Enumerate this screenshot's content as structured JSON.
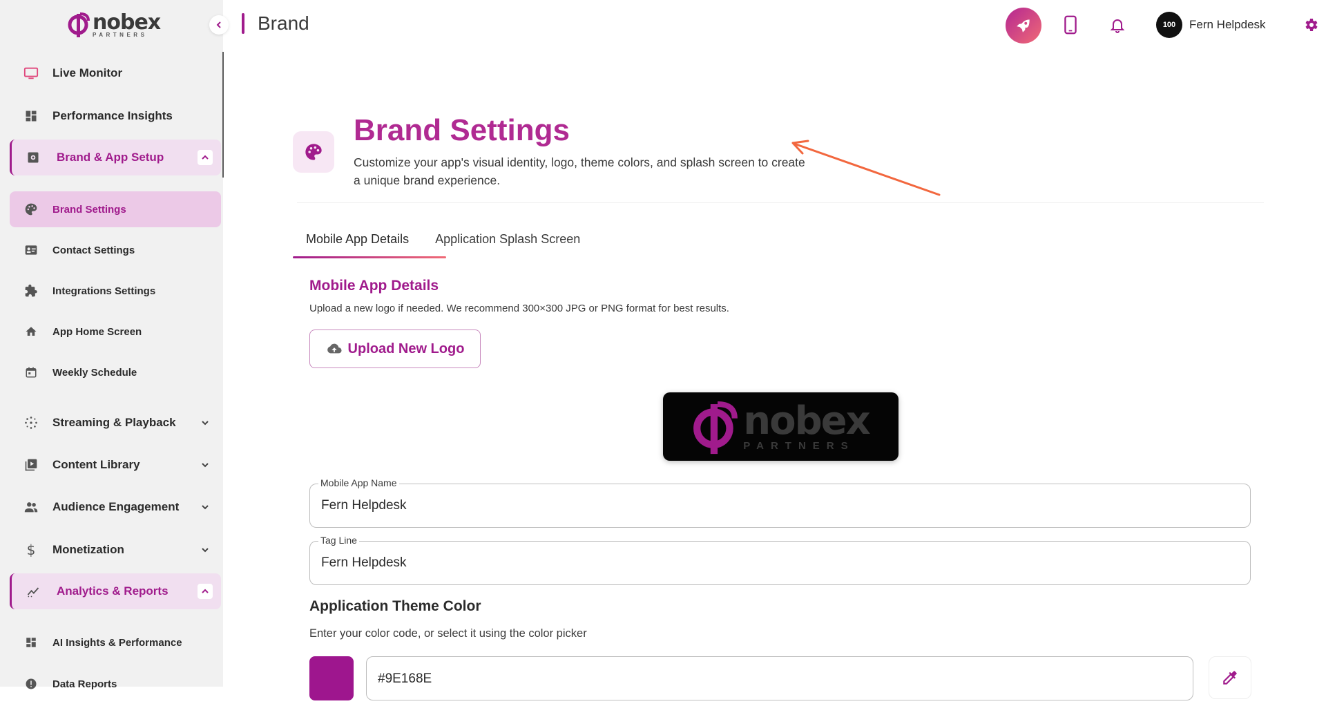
{
  "colors": {
    "accent": "#a01b8c",
    "accent_light": "#ecc9e7",
    "gradient_end": "#f06a76",
    "theme": "#9E168E"
  },
  "brand": {
    "word": "nobex",
    "sub": "PARTNERS"
  },
  "sidebar": {
    "items": [
      {
        "label": "Live Monitor",
        "icon": "monitor-icon"
      },
      {
        "label": "Performance Insights",
        "icon": "dashboard-icon"
      },
      {
        "label": "Brand & App Setup",
        "icon": "settings-box-icon"
      },
      {
        "label": "Brand Settings",
        "icon": "palette-icon"
      },
      {
        "label": "Contact Settings",
        "icon": "contact-card-icon"
      },
      {
        "label": "Integrations Settings",
        "icon": "puzzle-icon"
      },
      {
        "label": "App Home Screen",
        "icon": "home-icon"
      },
      {
        "label": "Weekly Schedule",
        "icon": "calendar-icon"
      },
      {
        "label": "Streaming & Playback",
        "icon": "streaming-icon"
      },
      {
        "label": "Content Library",
        "icon": "video-library-icon"
      },
      {
        "label": "Audience Engagement",
        "icon": "people-icon"
      },
      {
        "label": "Monetization",
        "icon": "dollar-icon"
      },
      {
        "label": "Analytics & Reports",
        "icon": "analytics-icon"
      },
      {
        "label": "AI Insights & Performance",
        "icon": "dashboard-icon"
      },
      {
        "label": "Data Reports",
        "icon": "info-icon"
      }
    ]
  },
  "topbar": {
    "title": "Brand",
    "user_name": "Fern Helpdesk",
    "avatar_text": "100"
  },
  "header": {
    "title": "Brand Settings",
    "description": "Customize your app's visual identity, logo, theme colors, and splash screen to create a unique brand experience."
  },
  "tabs": [
    {
      "label": "Mobile App Details",
      "active": true
    },
    {
      "label": "Application Splash Screen",
      "active": false
    }
  ],
  "mobile_app_details": {
    "title": "Mobile App Details",
    "description": "Upload a new logo if needed. We recommend 300×300 JPG or PNG format for best results.",
    "upload_label": "Upload New Logo",
    "app_name_label": "Mobile App Name",
    "app_name_value": "Fern Helpdesk",
    "tagline_label": "Tag Line",
    "tagline_value": "Fern Helpdesk"
  },
  "theme": {
    "title": "Application Theme Color",
    "description": "Enter your color code, or select it using the color picker",
    "value": "#9E168E"
  }
}
